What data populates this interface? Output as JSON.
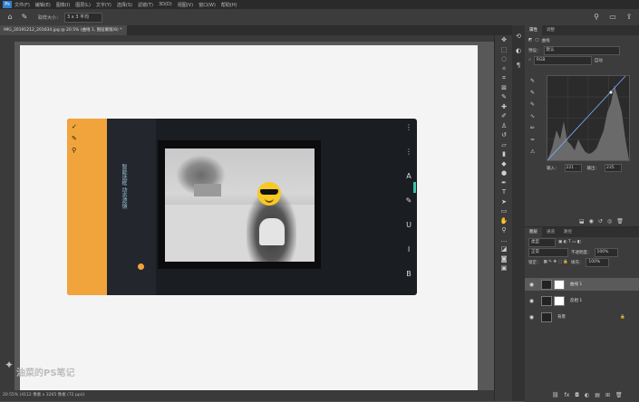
{
  "menubar": {
    "items": [
      "文件(F)",
      "编辑(E)",
      "图像(I)",
      "图层(L)",
      "文字(Y)",
      "选择(S)",
      "滤镜(T)",
      "3D(D)",
      "视图(V)",
      "窗口(W)",
      "帮助(H)"
    ]
  },
  "optionsbar": {
    "sample_label": "取样大小：",
    "sample_value": "3 x 3 平均"
  },
  "document": {
    "tab_title": "IMG_20191212_201634.jpg @ 20.5% (曲线 1, 图层蒙版/8) *"
  },
  "status": {
    "text": "20.55%  (4112 像素 x 3265 像素 (72 ppi))"
  },
  "watermark": {
    "text": "油菜的PS笔记"
  },
  "phone_ui": {
    "left_text": "智能选框  动态滤镜"
  },
  "properties": {
    "tabs": [
      "属性",
      "调整"
    ],
    "title": "曲线",
    "preset_label": "预设：",
    "preset_value": "默认",
    "channel_value": "RGB",
    "auto_label": "自动",
    "input_label": "输入：",
    "input_value": "221",
    "output_label": "输出：",
    "output_value": "235"
  },
  "layers": {
    "tabs": [
      "图层",
      "通道",
      "路径"
    ],
    "kind_label": "类型",
    "blend_mode": "正常",
    "opacity_label": "不透明度：",
    "opacity_value": "100%",
    "lock_label": "锁定：",
    "fill_label": "填充：",
    "fill_value": "100%",
    "items": [
      {
        "name": "曲线 1"
      },
      {
        "name": "反相 1"
      },
      {
        "name": "背景"
      }
    ]
  }
}
